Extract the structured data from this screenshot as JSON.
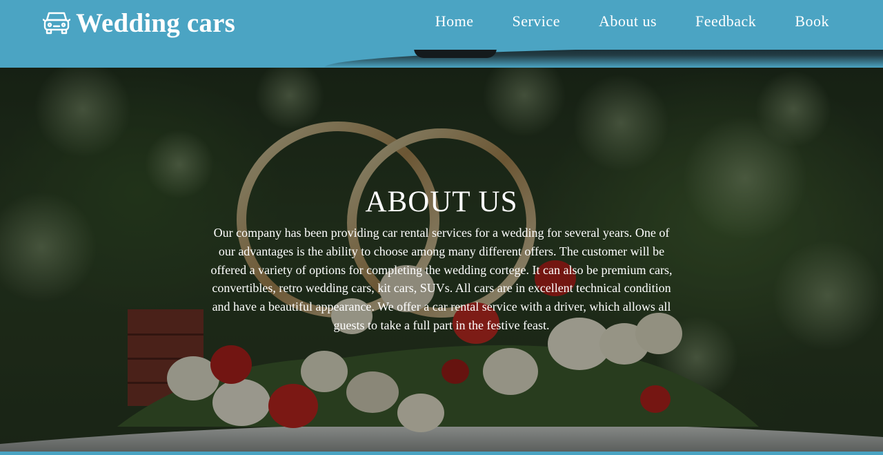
{
  "brand": {
    "name": "Wedding cars",
    "icon": "car-front-icon"
  },
  "nav": {
    "items": [
      {
        "label": "Home"
      },
      {
        "label": "Service"
      },
      {
        "label": "About us"
      },
      {
        "label": "Feedback"
      },
      {
        "label": "Book"
      }
    ]
  },
  "about": {
    "title": "ABOUT US",
    "text": "Our company has been providing car rental services for a wedding for several years. One of our advantages is the ability to choose among many different offers. The customer will be offered a variety of options for completing the wedding cortege. It can also be premium cars, convertibles, retro wedding cars, kit cars, SUVs. All cars are in excellent technical condition and have a beautiful appearance. We offer a car rental service with a driver, which allows all guests to take a full part in the festive feast."
  },
  "colors": {
    "header": "#4ba4c3",
    "text": "#ffffff"
  }
}
